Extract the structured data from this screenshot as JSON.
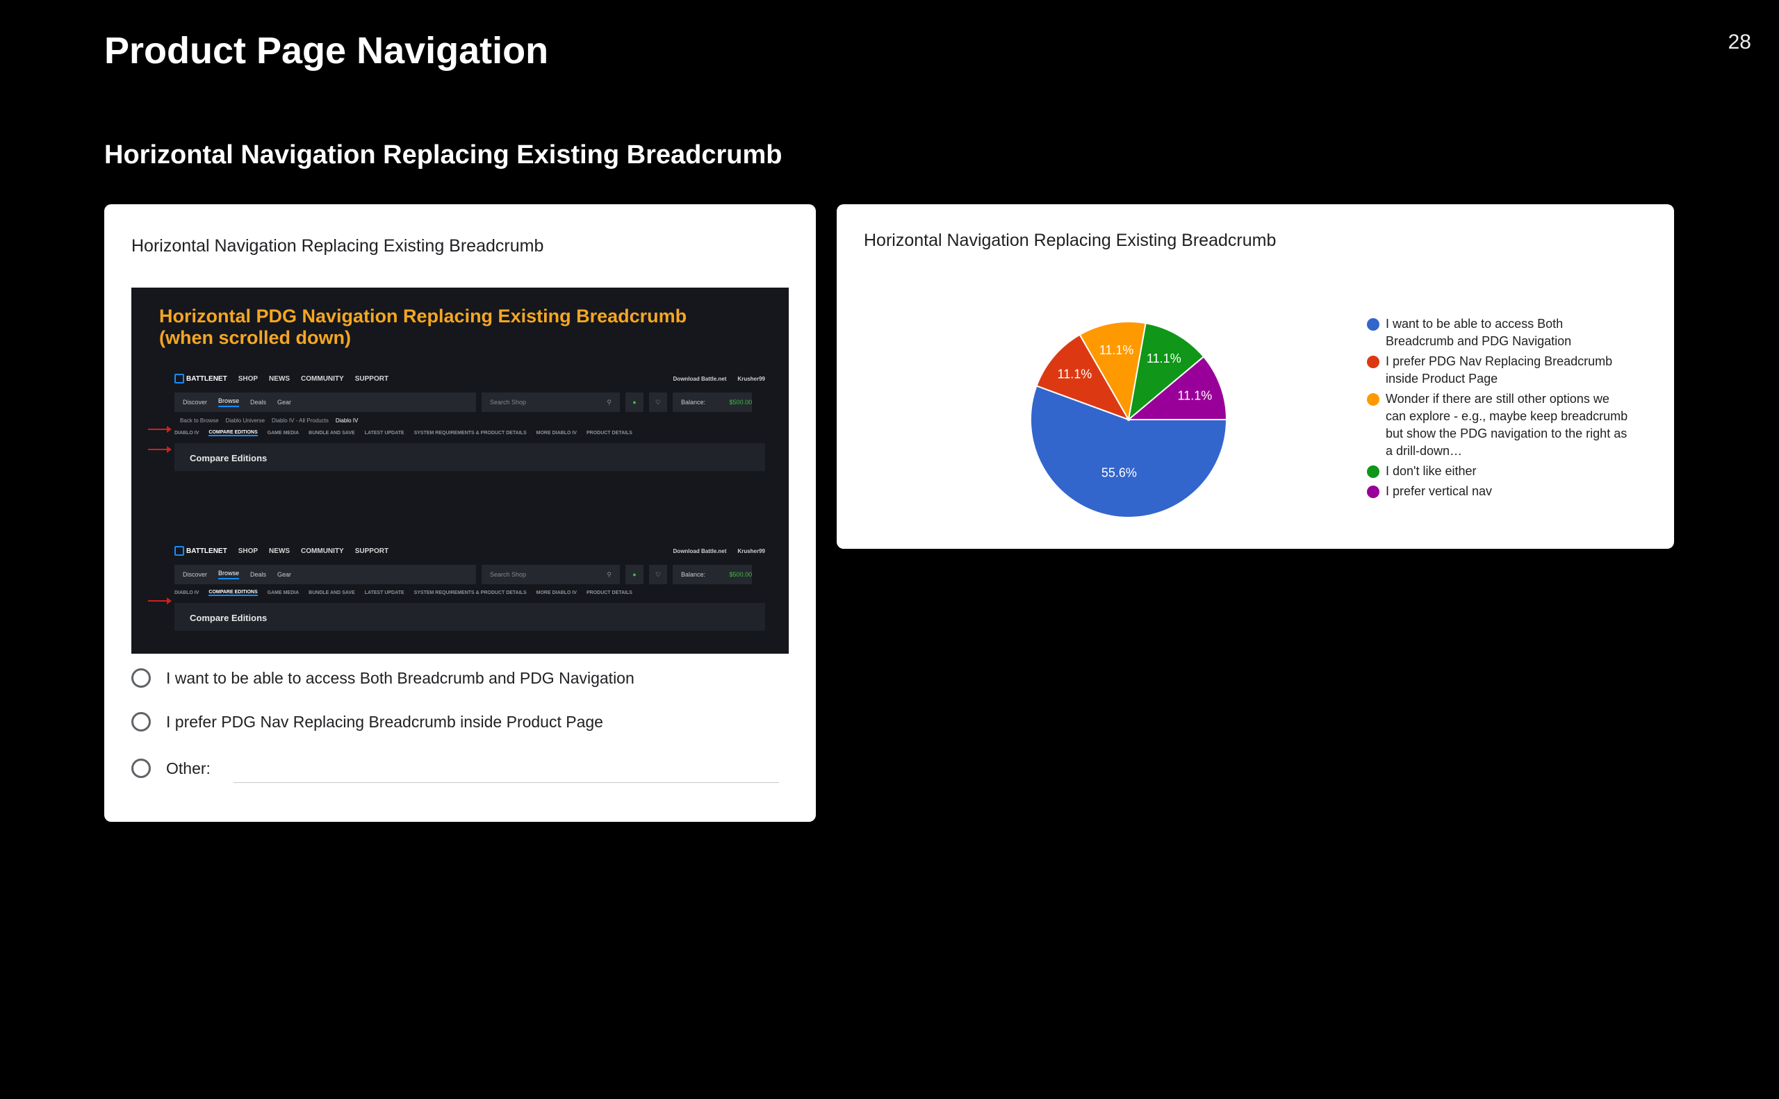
{
  "page": {
    "title": "Product Page Navigation",
    "number": "28",
    "subtitle": "Horizontal Navigation Replacing Existing Breadcrumb"
  },
  "survey": {
    "question": "Horizontal Navigation Replacing Existing Breadcrumb",
    "image": {
      "heading_line1": "Horizontal PDG Navigation Replacing Existing Breadcrumb",
      "heading_line2": "(when scrolled down)",
      "nav": {
        "logo": "BATTLENET",
        "items": [
          "SHOP",
          "NEWS",
          "COMMUNITY",
          "SUPPORT"
        ],
        "download": "Download Battle.net",
        "user": "Krusher99"
      },
      "subnav": {
        "items": [
          "Discover",
          "Browse",
          "Deals",
          "Gear"
        ],
        "search_placeholder": "Search Shop",
        "balance_label": "Balance:",
        "balance_value": "$500.00"
      },
      "breadcrumb": [
        "Back to Browse",
        "Diablo Universe",
        "Diablo IV - All Products",
        "Diablo IV"
      ],
      "pdg_tabs": [
        "DIABLO IV",
        "COMPARE EDITIONS",
        "GAME MEDIA",
        "BUNDLE AND SAVE",
        "LATEST UPDATE",
        "SYSTEM REQUIREMENTS & PRODUCT DETAILS",
        "MORE DIABLO IV",
        "PRODUCT DETAILS"
      ],
      "section_title": "Compare Editions"
    },
    "options": [
      "I want to be able to access Both Breadcrumb and PDG Navigation",
      "I prefer PDG Nav Replacing Breadcrumb inside Product Page",
      "Other:"
    ]
  },
  "results": {
    "title": "Horizontal Navigation Replacing Existing Breadcrumb",
    "colors": [
      "#3366cc",
      "#dc3912",
      "#ff9900",
      "#109618",
      "#990099"
    ]
  },
  "chart_data": {
    "type": "pie",
    "title": "Horizontal Navigation Replacing Existing Breadcrumb",
    "categories": [
      "I want to be able to access Both Breadcrumb and PDG Navigation",
      "I prefer PDG Nav Replacing Breadcrumb inside Product Page",
      "Wonder if there are still other options we can explore - e.g., maybe keep breadcrumb but show the PDG navigation to the right as a drill-down…",
      "I don't like either",
      "I prefer vertical nav"
    ],
    "values": [
      55.6,
      11.1,
      11.1,
      11.1,
      11.1
    ],
    "labels": [
      "55.6%",
      "11.1%",
      "11.1%",
      "11.1%",
      "11.1%"
    ],
    "legend": "right"
  }
}
